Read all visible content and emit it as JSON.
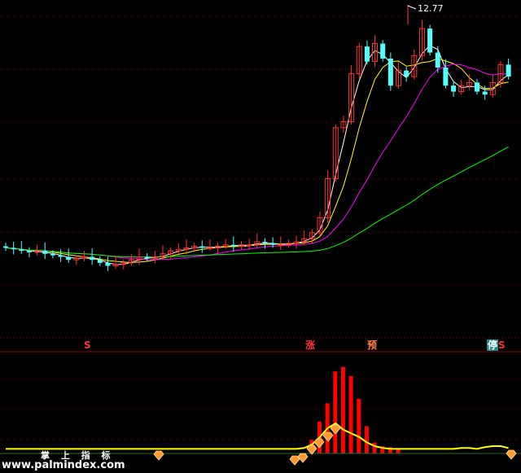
{
  "chart": {
    "peak_label": "12.77",
    "signals": [
      {
        "text": "S",
        "color": "#ff3030",
        "bg": ""
      },
      {
        "text": "涨",
        "color": "#ff3030",
        "bg": ""
      },
      {
        "text": "预",
        "color": "#ff8040",
        "bg": ""
      },
      {
        "text": "停",
        "color": "#ffffff",
        "bg": "#1b8b8b"
      },
      {
        "text": "S",
        "color": "#ff3030",
        "bg": ""
      }
    ]
  },
  "watermark": {
    "title": "掌 上 指 标",
    "url": "www.palmindex.com"
  },
  "colors": {
    "background": "#000000",
    "grid": "#8b0000",
    "up": "#ff3232",
    "down": "#54ffff",
    "ma_short": "#ffffff",
    "ma_mid": "#ffff00",
    "ma_long": "#ff00ff",
    "ma_very_long": "#00ff00",
    "indicator_bar": "#ff0000",
    "indicator_line": "#ffff00",
    "diamond": "#ff9a30"
  },
  "chart_data": {
    "type": "candlestick",
    "y_max_marked": 12.77,
    "candles_note": "approximate price path; values in price units",
    "closes": [
      4.9,
      4.85,
      4.8,
      4.75,
      4.8,
      4.7,
      4.65,
      4.6,
      4.5,
      4.55,
      4.6,
      4.5,
      4.4,
      4.3,
      4.35,
      4.4,
      4.5,
      4.6,
      4.55,
      4.6,
      4.7,
      4.8,
      4.85,
      4.9,
      4.95,
      4.9,
      4.9,
      4.95,
      5.0,
      4.95,
      5.0,
      5.0,
      5.1,
      5.05,
      5.0,
      5.0,
      5.05,
      5.1,
      5.2,
      5.4,
      5.9,
      7.2,
      8.9,
      9.1,
      10.7,
      11.6,
      11.1,
      11.7,
      11.2,
      10.3,
      10.8,
      10.6,
      11.3,
      12.2,
      11.4,
      10.9,
      10.3,
      10.1,
      10.3,
      10.4,
      10.1,
      10.0,
      10.4,
      11.0,
      10.6
    ],
    "indicator_bars": [
      0,
      0,
      0,
      0,
      0,
      0,
      0,
      0,
      0,
      0,
      0,
      0,
      0,
      0,
      0,
      0,
      0,
      0,
      0,
      0,
      0,
      0,
      0,
      0,
      0,
      0,
      0,
      0,
      0,
      0,
      0,
      0,
      0,
      0,
      0,
      0,
      0,
      0,
      0,
      0.15,
      0.35,
      0.55,
      0.9,
      0.95,
      0.85,
      0.6,
      0.3,
      0.12,
      0.08,
      0.07,
      0.06,
      0,
      0,
      0,
      0,
      0,
      0,
      0,
      0,
      0,
      0,
      0,
      0,
      0,
      0
    ],
    "indicator_line": [
      0.05,
      0.05,
      0.05,
      0.05,
      0.05,
      0.05,
      0.05,
      0.05,
      0.05,
      0.05,
      0.05,
      0.05,
      0.05,
      0.05,
      0.05,
      0.05,
      0.05,
      0.05,
      0.05,
      0.05,
      0.05,
      0.05,
      0.05,
      0.05,
      0.05,
      0.05,
      0.05,
      0.05,
      0.05,
      0.05,
      0.05,
      0.05,
      0.05,
      0.05,
      0.05,
      0.05,
      0.05,
      0.05,
      0.06,
      0.1,
      0.18,
      0.28,
      0.33,
      0.26,
      0.22,
      0.18,
      0.12,
      0.08,
      0.06,
      0.05,
      0.05,
      0.05,
      0.05,
      0.05,
      0.05,
      0.05,
      0.05,
      0.05,
      0.06,
      0.06,
      0.05,
      0.07,
      0.08,
      0.08,
      0.06
    ]
  }
}
